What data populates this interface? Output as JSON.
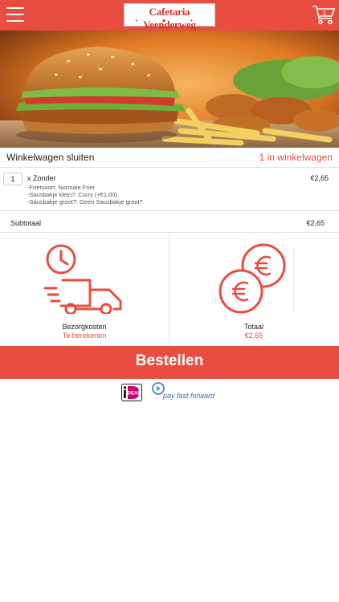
{
  "header": {
    "logo_text": "Cafetaria Veenderweg",
    "logo_stars": "• ★ •",
    "cart_count": "1"
  },
  "cart_bar": {
    "close_label": "Winkelwagen sluiten",
    "items_label": "1 in winkelwagen"
  },
  "item": {
    "quantity": "1",
    "name": "x Zonder",
    "options": [
      "-Frietsoort: Normale Friet",
      "-Sausbakje klein?: Curry (+€1,00)",
      "-Sausbakje groot?: Geen Sausbakje groot?"
    ],
    "price": "€2,65"
  },
  "subtotal": {
    "label": "Subtotaal",
    "value": "€2,65"
  },
  "delivery": {
    "label": "Bezorgkosten",
    "value": "Te berekenen"
  },
  "total": {
    "label": "Totaal",
    "value": "€2,65"
  },
  "order_button": {
    "label": "Bestellen"
  },
  "payment": {
    "ideal_text": "iDEAL",
    "payff_text": "pay fast forward"
  },
  "colors": {
    "accent": "#e84d3f"
  }
}
